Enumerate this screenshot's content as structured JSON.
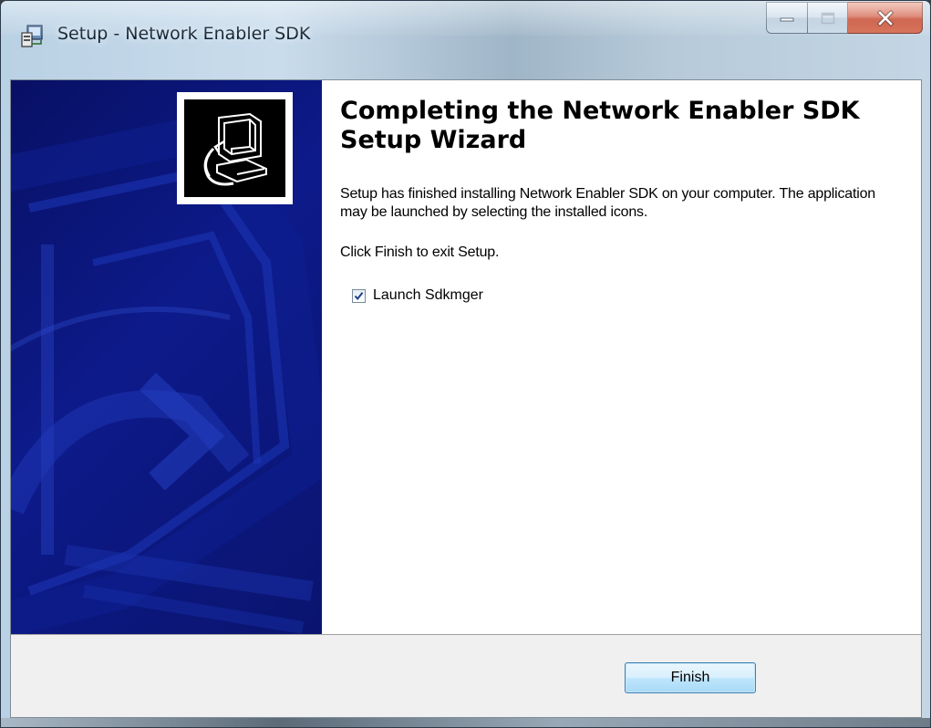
{
  "window": {
    "title": "Setup - Network Enabler SDK",
    "icon": "setup-installer-icon"
  },
  "caption_buttons": {
    "minimize_icon": "minimize-icon",
    "maximize_icon": "maximize-icon",
    "close_icon": "close-icon"
  },
  "wizard": {
    "heading": "Completing the Network Enabler SDK Setup Wizard",
    "finished_text": "Setup has finished installing Network Enabler SDK on your computer. The application may be launched by selecting the installed icons.",
    "exit_text": "Click Finish to exit Setup.",
    "launch_checkbox": {
      "label": "Launch Sdkmger",
      "checked": true
    }
  },
  "footer": {
    "finish_label": "Finish"
  },
  "colors": {
    "banner": "#0d1a8a",
    "button_accent": "#3c7fb1",
    "close_button": "#c1381d"
  }
}
